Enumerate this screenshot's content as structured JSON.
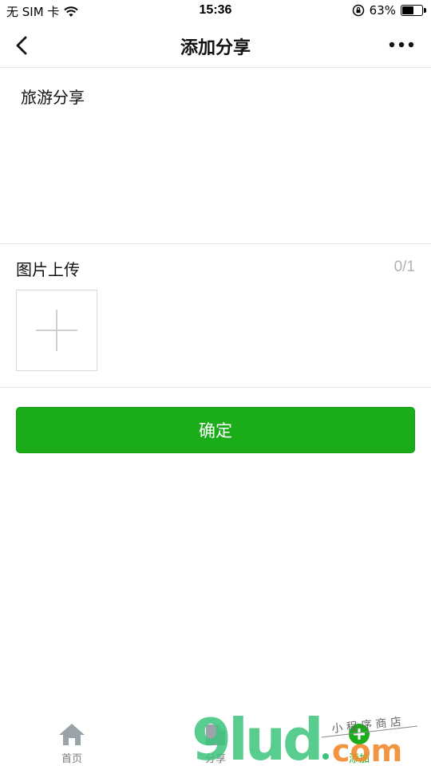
{
  "status": {
    "carrier": "无 SIM 卡",
    "time": "15:36",
    "battery": "63%",
    "battery_level": 0.63
  },
  "nav": {
    "title": "添加分享",
    "back_icon": "chevron-left-icon",
    "more_icon": "more-dots-icon"
  },
  "content": {
    "value": "旅游分享"
  },
  "upload": {
    "title": "图片上传",
    "count": "0/1",
    "add_icon": "plus-icon"
  },
  "confirm": {
    "label": "确定",
    "color": "#1aad19"
  },
  "tabs": [
    {
      "label": "首页",
      "icon": "home-icon",
      "active": false
    },
    {
      "label": "分享",
      "icon": "share-icon",
      "active": false
    },
    {
      "label": "添加",
      "icon": "add-icon",
      "active": true
    }
  ],
  "watermark": {
    "logo": "9lud.com",
    "tagline": "小程序商店"
  }
}
